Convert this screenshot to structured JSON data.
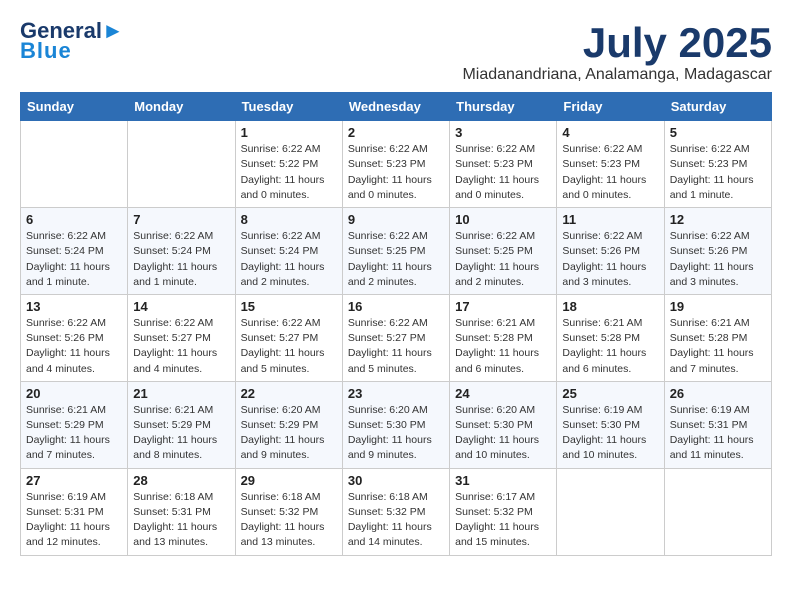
{
  "header": {
    "logo_line1": "General",
    "logo_line2": "Blue",
    "month": "July 2025",
    "location": "Miadanandriana, Analamanga, Madagascar"
  },
  "days_of_week": [
    "Sunday",
    "Monday",
    "Tuesday",
    "Wednesday",
    "Thursday",
    "Friday",
    "Saturday"
  ],
  "weeks": [
    [
      {
        "day": "",
        "info": ""
      },
      {
        "day": "",
        "info": ""
      },
      {
        "day": "1",
        "info": "Sunrise: 6:22 AM\nSunset: 5:22 PM\nDaylight: 11 hours and 0 minutes."
      },
      {
        "day": "2",
        "info": "Sunrise: 6:22 AM\nSunset: 5:23 PM\nDaylight: 11 hours and 0 minutes."
      },
      {
        "day": "3",
        "info": "Sunrise: 6:22 AM\nSunset: 5:23 PM\nDaylight: 11 hours and 0 minutes."
      },
      {
        "day": "4",
        "info": "Sunrise: 6:22 AM\nSunset: 5:23 PM\nDaylight: 11 hours and 0 minutes."
      },
      {
        "day": "5",
        "info": "Sunrise: 6:22 AM\nSunset: 5:23 PM\nDaylight: 11 hours and 1 minute."
      }
    ],
    [
      {
        "day": "6",
        "info": "Sunrise: 6:22 AM\nSunset: 5:24 PM\nDaylight: 11 hours and 1 minute."
      },
      {
        "day": "7",
        "info": "Sunrise: 6:22 AM\nSunset: 5:24 PM\nDaylight: 11 hours and 1 minute."
      },
      {
        "day": "8",
        "info": "Sunrise: 6:22 AM\nSunset: 5:24 PM\nDaylight: 11 hours and 2 minutes."
      },
      {
        "day": "9",
        "info": "Sunrise: 6:22 AM\nSunset: 5:25 PM\nDaylight: 11 hours and 2 minutes."
      },
      {
        "day": "10",
        "info": "Sunrise: 6:22 AM\nSunset: 5:25 PM\nDaylight: 11 hours and 2 minutes."
      },
      {
        "day": "11",
        "info": "Sunrise: 6:22 AM\nSunset: 5:26 PM\nDaylight: 11 hours and 3 minutes."
      },
      {
        "day": "12",
        "info": "Sunrise: 6:22 AM\nSunset: 5:26 PM\nDaylight: 11 hours and 3 minutes."
      }
    ],
    [
      {
        "day": "13",
        "info": "Sunrise: 6:22 AM\nSunset: 5:26 PM\nDaylight: 11 hours and 4 minutes."
      },
      {
        "day": "14",
        "info": "Sunrise: 6:22 AM\nSunset: 5:27 PM\nDaylight: 11 hours and 4 minutes."
      },
      {
        "day": "15",
        "info": "Sunrise: 6:22 AM\nSunset: 5:27 PM\nDaylight: 11 hours and 5 minutes."
      },
      {
        "day": "16",
        "info": "Sunrise: 6:22 AM\nSunset: 5:27 PM\nDaylight: 11 hours and 5 minutes."
      },
      {
        "day": "17",
        "info": "Sunrise: 6:21 AM\nSunset: 5:28 PM\nDaylight: 11 hours and 6 minutes."
      },
      {
        "day": "18",
        "info": "Sunrise: 6:21 AM\nSunset: 5:28 PM\nDaylight: 11 hours and 6 minutes."
      },
      {
        "day": "19",
        "info": "Sunrise: 6:21 AM\nSunset: 5:28 PM\nDaylight: 11 hours and 7 minutes."
      }
    ],
    [
      {
        "day": "20",
        "info": "Sunrise: 6:21 AM\nSunset: 5:29 PM\nDaylight: 11 hours and 7 minutes."
      },
      {
        "day": "21",
        "info": "Sunrise: 6:21 AM\nSunset: 5:29 PM\nDaylight: 11 hours and 8 minutes."
      },
      {
        "day": "22",
        "info": "Sunrise: 6:20 AM\nSunset: 5:29 PM\nDaylight: 11 hours and 9 minutes."
      },
      {
        "day": "23",
        "info": "Sunrise: 6:20 AM\nSunset: 5:30 PM\nDaylight: 11 hours and 9 minutes."
      },
      {
        "day": "24",
        "info": "Sunrise: 6:20 AM\nSunset: 5:30 PM\nDaylight: 11 hours and 10 minutes."
      },
      {
        "day": "25",
        "info": "Sunrise: 6:19 AM\nSunset: 5:30 PM\nDaylight: 11 hours and 10 minutes."
      },
      {
        "day": "26",
        "info": "Sunrise: 6:19 AM\nSunset: 5:31 PM\nDaylight: 11 hours and 11 minutes."
      }
    ],
    [
      {
        "day": "27",
        "info": "Sunrise: 6:19 AM\nSunset: 5:31 PM\nDaylight: 11 hours and 12 minutes."
      },
      {
        "day": "28",
        "info": "Sunrise: 6:18 AM\nSunset: 5:31 PM\nDaylight: 11 hours and 13 minutes."
      },
      {
        "day": "29",
        "info": "Sunrise: 6:18 AM\nSunset: 5:32 PM\nDaylight: 11 hours and 13 minutes."
      },
      {
        "day": "30",
        "info": "Sunrise: 6:18 AM\nSunset: 5:32 PM\nDaylight: 11 hours and 14 minutes."
      },
      {
        "day": "31",
        "info": "Sunrise: 6:17 AM\nSunset: 5:32 PM\nDaylight: 11 hours and 15 minutes."
      },
      {
        "day": "",
        "info": ""
      },
      {
        "day": "",
        "info": ""
      }
    ]
  ]
}
